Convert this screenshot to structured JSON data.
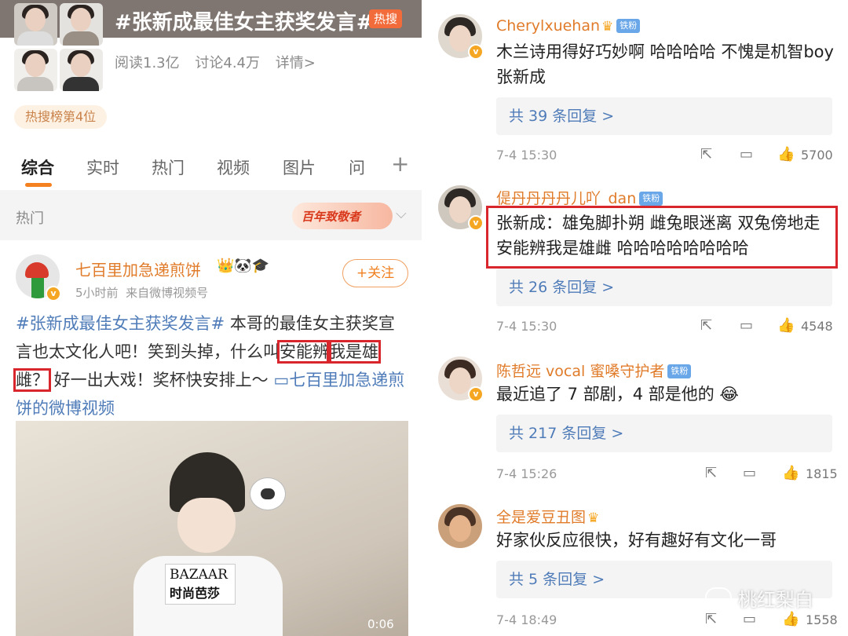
{
  "topic": {
    "title": "#张新成最佳女主获奖发言#",
    "hot_badge": "热搜",
    "reads": "阅读1.3亿",
    "discussions": "讨论4.4万",
    "details": "详情>",
    "rank": "热搜榜第4位"
  },
  "tabs": [
    "综合",
    "实时",
    "热门",
    "视频",
    "图片",
    "问"
  ],
  "tab_plus": "+",
  "section": {
    "label": "热门",
    "banner_text": "百年致敬者"
  },
  "post": {
    "username": "七百里加急递煎饼",
    "user_icons": "👑🐼🎓",
    "time": "5小时前",
    "source": "来自微博视频号",
    "follow": "+关注",
    "tag": "#张新成最佳女主获奖发言#",
    "text_a": " 本哥的最佳女主获奖宣言也太文化人吧！笑到头掉，什么叫",
    "boxed_a": "安能辨",
    "boxed_b": "我是雄雌？",
    "text_b": " 好一出大戏！奖杯快安排上～ ",
    "video_link": "▭七百里加急递煎饼的微博视频",
    "video": {
      "card_line1": "BAZAAR",
      "card_line2": "时尚芭莎",
      "duration": "0:06"
    }
  },
  "comments": [
    {
      "name": "Cherylxuehan",
      "fan_badge": "铁粉",
      "text": "木兰诗用得好巧妙啊 哈哈哈哈 不愧是机智boy张新成",
      "replies": "共 39 条回复 >",
      "time": "7-4 15:30",
      "likes": "5700"
    },
    {
      "name": "偍丹丹丹丹儿吖_dan",
      "fan_badge": "铁粉",
      "text": "张新成：雄兔脚扑朔 雌兔眼迷离 双兔傍地走 安能辨我是雄雌 哈哈哈哈哈哈哈哈",
      "replies": "共 26 条回复 >",
      "time": "7-4 15:30",
      "likes": "4548"
    },
    {
      "name": "陈哲远 vocal 蜜嗓守护者",
      "fan_badge": "铁粉",
      "text": "最近追了 7 部剧，4 部是他的 😂",
      "replies": "共 217 条回复 >",
      "time": "7-4 15:26",
      "likes": "1815"
    },
    {
      "name": "全是爱豆丑图",
      "fan_badge": "",
      "text": "好家伙反应很快，好有趣好有文化一哥",
      "replies": "共 5 条回复 >",
      "time": "7-4 18:49",
      "likes": "1558"
    }
  ],
  "icons": {
    "share": "share-icon",
    "comment": "comment-icon",
    "like": "like-icon"
  },
  "watermark": "桃红梨白",
  "colors": {
    "accent": "#f5801f",
    "username": "#e07b2a",
    "link": "#4f7cb8",
    "highlight_box": "#d8262c"
  }
}
